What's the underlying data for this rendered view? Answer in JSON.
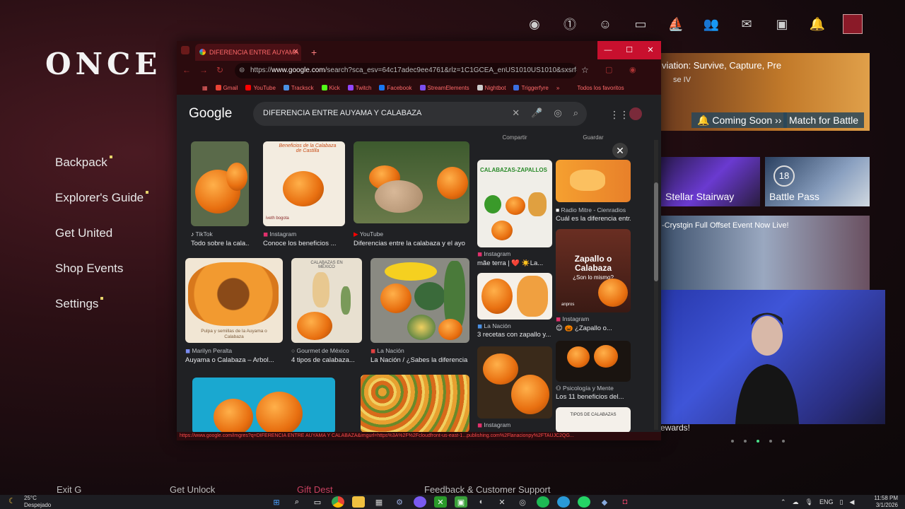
{
  "game": {
    "logo": "ONCE H",
    "menu": [
      "Backpack",
      "Explorer's Guide",
      "Get United",
      "Shop Events",
      "Settings"
    ],
    "banner": {
      "title": "viation: Survive, Capture, Pre",
      "subtitle": "se IV",
      "coming_soon": "Coming Soon",
      "match": "Match for Battle"
    },
    "tiles": [
      {
        "label": "Stellar Stairway"
      },
      {
        "label": "Battle Pass",
        "badge": "18"
      }
    ],
    "event_text": "-Crystgin Full Offset Event Now Live!",
    "rewards": "rewards!",
    "bottom_items": [
      "Exit G",
      "Get Unlock",
      "Gift Dest",
      "Feedback & Customer Support"
    ]
  },
  "browser": {
    "tab_title": "DIFERENCIA ENTRE AUYAMA",
    "url_prefix": "https://",
    "url_domain": "www.google.com",
    "url_rest": "/search?sca_esv=64c17adec9ee4761&rlz=1C1GCEA_enUS1010US1010&sxsrf=ANbL-...",
    "bookmarks": [
      {
        "label": "Gmail",
        "color": "#ea4335"
      },
      {
        "label": "YouTube",
        "color": "#ff0000"
      },
      {
        "label": "Tracksck",
        "color": "#4a90e2"
      },
      {
        "label": "Kick",
        "color": "#53fc18"
      },
      {
        "label": "Twitch",
        "color": "#9146ff"
      },
      {
        "label": "Facebook",
        "color": "#1877f2"
      },
      {
        "label": "StreamElements",
        "color": "#7b4ef0"
      },
      {
        "label": "Nightbot",
        "color": "#cccccc"
      },
      {
        "label": "Triggerfyre",
        "color": "#3b6fe0"
      }
    ],
    "bookmarks_all": "Todos los favoritos",
    "google_logo": "Google",
    "query": "DIFERENCIA ENTRE AUYAMA Y CALABAZA",
    "status_url": "https://www.google.com/imgres?q=DIFERENCIA ENTRE AUYAMA Y CALABAZA&imgurl=https%3A%2F%2Fcloudfront-us-east-1...publishing.com%2Flanacionpy%2FTAUJC2QG..."
  },
  "results": [
    {
      "source": "TikTok",
      "title": "Todo sobre la cala...",
      "src_color": "#ffffff"
    },
    {
      "source": "Instagram",
      "title": "Conoce los beneficios ...",
      "src_color": "#e1306c"
    },
    {
      "source": "YouTube",
      "title": "Diferencias entre la calabaza y el ayo",
      "src_color": "#ff0000"
    },
    {
      "source": "Instagram",
      "title": "mãe terra | ❤️ ☀️La...",
      "src_color": "#e1306c"
    },
    {
      "source": "Radio Mitre - Cienradios",
      "title": "Cuál es la diferencia entr...",
      "src_color": "#ffffff"
    },
    {
      "source": "Marilyn Peralta",
      "title": "Auyama o Calabaza – Arbol...",
      "src_color": "#7a8cf0"
    },
    {
      "source": "Gourmet de México",
      "title": "4 tipos de calabaza...",
      "src_color": "#aaaaaa"
    },
    {
      "source": "La Nación",
      "title": "La Nación / ¿Sabes la diferencia",
      "src_color": "#e04040"
    },
    {
      "source": "La Nación",
      "title": "3 recetas con zapallo y...",
      "src_color": "#4a90e2"
    },
    {
      "source": "Instagram",
      "title": "😊 🎃 ¿Zapallo o...",
      "src_color": "#e1306c"
    },
    {
      "source": "Psicología y Mente",
      "title": "Los 11 beneficios del...",
      "src_color": "#ffffff"
    },
    {
      "source": "Instagram",
      "title": "",
      "src_color": "#e1306c"
    }
  ],
  "image_text": {
    "beneficios": "Beneficios de la Calabaza de Castilla",
    "calabazas_zapallos": "CALABAZAS-ZAPALLOS",
    "zapallo_o_calabaza": "Zapallo o Calabaza",
    "son_lo_mismo": "¿Son lo mismo?",
    "pulpa": "Pulpa y semillas de la Auyama o Calabaza",
    "calabazas_mexico": "CALABAZAS EN MÉXICO",
    "tipos": "TIPOS DE CALABAZAS",
    "iveth": "iveth bogota",
    "anpros": "anpros"
  },
  "top_actions": {
    "share": "Compartir",
    "save": "Guardar"
  },
  "taskbar": {
    "temp": "25°C",
    "weather": "Despejado",
    "lang": "ENG",
    "time": "11:58 PM",
    "date": "3/1/2026"
  }
}
